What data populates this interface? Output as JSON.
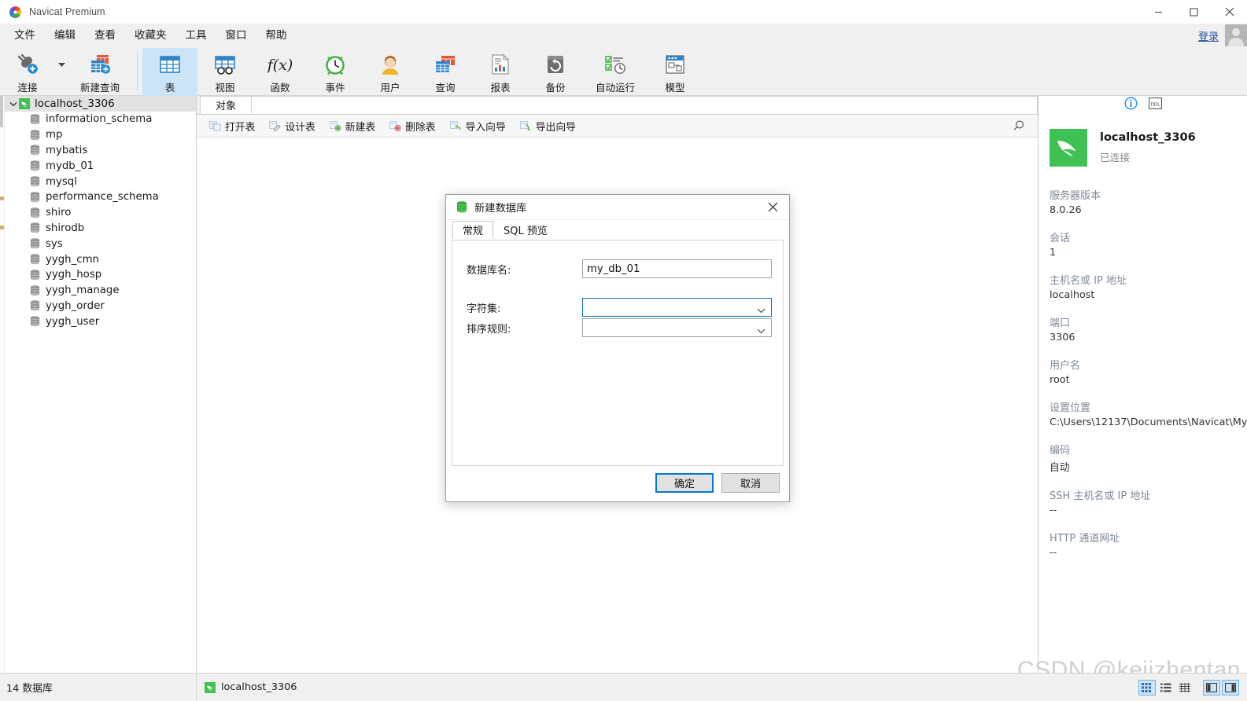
{
  "window": {
    "title": "Navicat Premium",
    "minimize_label": "—",
    "maximize_label": "□",
    "close_label": "✕"
  },
  "menubar": {
    "items": [
      {
        "label": "文件"
      },
      {
        "label": "编辑"
      },
      {
        "label": "查看"
      },
      {
        "label": "收藏夹"
      },
      {
        "label": "工具"
      },
      {
        "label": "窗口"
      },
      {
        "label": "帮助"
      }
    ],
    "login_label": "登录"
  },
  "toolbar": {
    "buttons": [
      {
        "label": "连接",
        "icon": "connection-icon",
        "active": false
      },
      {
        "label": "新建查询",
        "icon": "new-query-icon",
        "active": false
      },
      {
        "label": "表",
        "icon": "table-icon",
        "active": true
      },
      {
        "label": "视图",
        "icon": "view-icon",
        "active": false
      },
      {
        "label": "函数",
        "icon": "function-icon",
        "active": false
      },
      {
        "label": "事件",
        "icon": "event-icon",
        "active": false
      },
      {
        "label": "用户",
        "icon": "user-icon",
        "active": false
      },
      {
        "label": "查询",
        "icon": "query-icon",
        "active": false
      },
      {
        "label": "报表",
        "icon": "report-icon",
        "active": false
      },
      {
        "label": "备份",
        "icon": "backup-icon",
        "active": false
      },
      {
        "label": "自动运行",
        "icon": "automation-icon",
        "active": false
      },
      {
        "label": "模型",
        "icon": "model-icon",
        "active": false
      }
    ]
  },
  "sidebar": {
    "root": {
      "label": "localhost_3306",
      "expanded": true
    },
    "databases": [
      {
        "label": "information_schema"
      },
      {
        "label": "mp"
      },
      {
        "label": "mybatis"
      },
      {
        "label": "mydb_01"
      },
      {
        "label": "mysql"
      },
      {
        "label": "performance_schema"
      },
      {
        "label": "shiro"
      },
      {
        "label": "shirodb"
      },
      {
        "label": "sys"
      },
      {
        "label": "yygh_cmn"
      },
      {
        "label": "yygh_hosp"
      },
      {
        "label": "yygh_manage"
      },
      {
        "label": "yygh_order"
      },
      {
        "label": "yygh_user"
      }
    ]
  },
  "main": {
    "tab_label": "对象",
    "object_buttons": [
      {
        "label": "打开表",
        "icon": "open-table-icon"
      },
      {
        "label": "设计表",
        "icon": "design-table-icon"
      },
      {
        "label": "新建表",
        "icon": "new-table-icon"
      },
      {
        "label": "删除表",
        "icon": "delete-table-icon"
      },
      {
        "label": "导入向导",
        "icon": "import-wizard-icon"
      },
      {
        "label": "导出向导",
        "icon": "export-wizard-icon"
      }
    ],
    "search_icon": "search-icon"
  },
  "info_panel": {
    "tabs": [
      {
        "icon": "info-icon",
        "label": "信息"
      },
      {
        "icon": "ddl-icon",
        "label": "DDL"
      }
    ],
    "connection_name": "localhost_3306",
    "connection_state": "已连接",
    "rows": [
      {
        "key": "服务器版本",
        "value": "8.0.26"
      },
      {
        "key": "会话",
        "value": "1"
      },
      {
        "key": "主机名或 IP 地址",
        "value": "localhost"
      },
      {
        "key": "端口",
        "value": "3306"
      },
      {
        "key": "用户名",
        "value": "root"
      },
      {
        "key": "设置位置",
        "value": "C:\\Users\\12137\\Documents\\Navicat\\My"
      },
      {
        "key": "编码",
        "value": "自动"
      },
      {
        "key": "SSH 主机名或 IP 地址",
        "value": "--"
      },
      {
        "key": "HTTP 通道网址",
        "value": "--"
      }
    ]
  },
  "dialog": {
    "title": "新建数据库",
    "title_icon": "database-icon",
    "close_label": "✕",
    "tabs": [
      {
        "label": "常规",
        "active": true
      },
      {
        "label": "SQL 预览",
        "active": false
      }
    ],
    "fields": [
      {
        "label": "数据库名:",
        "type": "text",
        "value": "my_db_01",
        "placeholder": ""
      },
      {
        "label": "字符集:",
        "type": "combo",
        "value": "",
        "focused": true
      },
      {
        "label": "排序规则:",
        "type": "combo",
        "value": "",
        "focused": false
      }
    ],
    "ok_label": "确定",
    "cancel_label": "取消"
  },
  "statusbar": {
    "db_count_text": "14 数据库",
    "connection_text": "localhost_3306",
    "view_buttons": [
      {
        "icon": "grid-view-icon",
        "selected": true
      },
      {
        "icon": "list-view-icon",
        "selected": false
      },
      {
        "icon": "detail-view-icon",
        "selected": false
      },
      {
        "icon": "left-pane-icon",
        "selected": true
      },
      {
        "icon": "right-pane-icon",
        "selected": true
      }
    ]
  },
  "watermark": {
    "text": "CSDN @kejizhentan"
  },
  "colors": {
    "accent_blue": "#0078d7",
    "selected_tab_bg": "#cce4f7",
    "navicat_green": "#3fc253",
    "menu_bg": "#f0f0f0",
    "link_blue": "#1f4fa0"
  }
}
